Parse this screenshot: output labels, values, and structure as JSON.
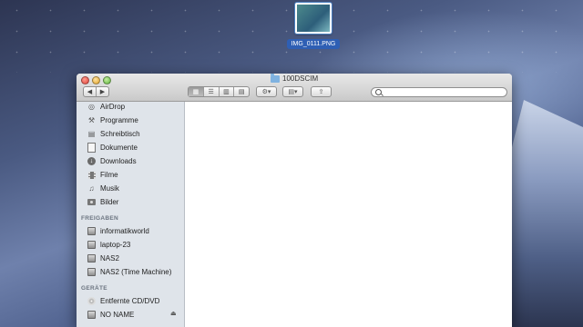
{
  "desktop": {
    "file_label": "IMG_0111.PNG"
  },
  "window": {
    "title": "100DSCIM",
    "toolbar": {
      "back": "◀",
      "forward": "▶",
      "views": [
        "icon-view",
        "list-view",
        "column-view",
        "coverflow-view"
      ],
      "action": "⚙▾",
      "arrange": "▤▾",
      "share": "⇪",
      "search_placeholder": ""
    },
    "sidebar": {
      "favorites": [
        {
          "label": "AirDrop",
          "icon": "airdrop-icon"
        },
        {
          "label": "Programme",
          "icon": "applications-icon"
        },
        {
          "label": "Schreibtisch",
          "icon": "desktop-icon"
        },
        {
          "label": "Dokumente",
          "icon": "documents-icon"
        },
        {
          "label": "Downloads",
          "icon": "downloads-icon"
        },
        {
          "label": "Filme",
          "icon": "movies-icon"
        },
        {
          "label": "Musik",
          "icon": "music-icon"
        },
        {
          "label": "Bilder",
          "icon": "pictures-icon"
        }
      ],
      "shared_header": "FREIGABEN",
      "shared": [
        {
          "label": "informatikworld",
          "icon": "network-computer-icon"
        },
        {
          "label": "laptop-23",
          "icon": "network-computer-icon"
        },
        {
          "label": "NAS2",
          "icon": "network-display-icon"
        },
        {
          "label": "NAS2 (Time Machine)",
          "icon": "network-display-icon"
        }
      ],
      "devices_header": "GERÄTE",
      "devices": [
        {
          "label": "Entfernte CD/DVD",
          "icon": "cd-icon"
        },
        {
          "label": "NO NAME",
          "icon": "disk-icon",
          "eject": "⏏"
        }
      ]
    }
  }
}
